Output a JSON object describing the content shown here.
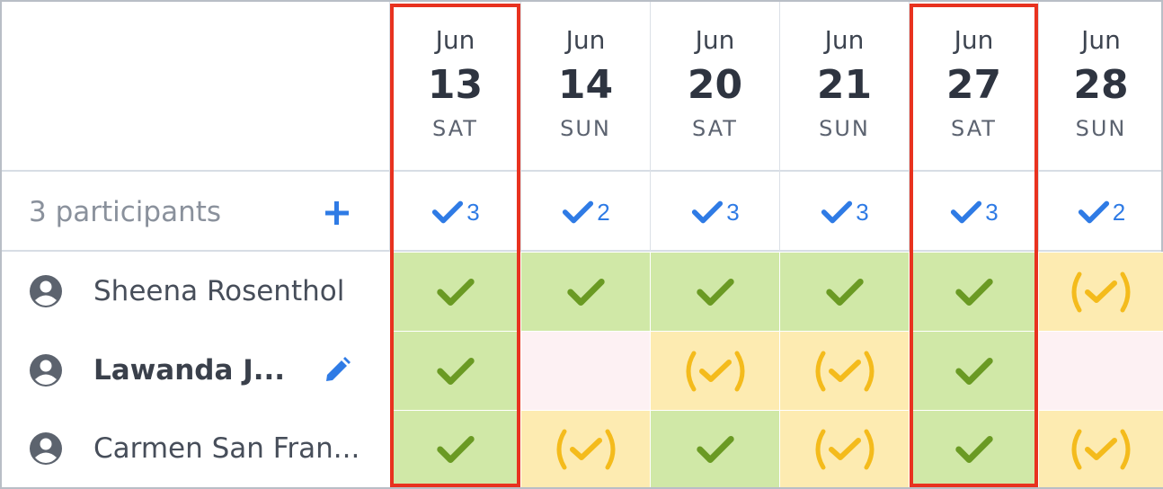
{
  "columns": [
    {
      "month": "Jun",
      "day": "13",
      "weekday": "SAT",
      "count": "3"
    },
    {
      "month": "Jun",
      "day": "14",
      "weekday": "SUN",
      "count": "2"
    },
    {
      "month": "Jun",
      "day": "20",
      "weekday": "SAT",
      "count": "3"
    },
    {
      "month": "Jun",
      "day": "21",
      "weekday": "SUN",
      "count": "3"
    },
    {
      "month": "Jun",
      "day": "27",
      "weekday": "SAT",
      "count": "3"
    },
    {
      "month": "Jun",
      "day": "28",
      "weekday": "SUN",
      "count": "2"
    }
  ],
  "participants_label": "3 participants",
  "participants": [
    {
      "name": "Sheena Rosenthol",
      "bold": false,
      "editable": false,
      "votes": [
        "yes",
        "yes",
        "yes",
        "yes",
        "yes",
        "maybe"
      ]
    },
    {
      "name": "Lawanda J...",
      "bold": true,
      "editable": true,
      "votes": [
        "yes",
        "no",
        "maybe",
        "maybe",
        "yes",
        "no"
      ]
    },
    {
      "name": "Carmen San Fran...",
      "bold": false,
      "editable": false,
      "votes": [
        "yes",
        "maybe",
        "yes",
        "maybe",
        "yes",
        "maybe"
      ]
    }
  ],
  "highlighted_columns": [
    0,
    4
  ],
  "icons": {
    "add": "plus-icon",
    "edit": "pencil-icon",
    "person": "user-circle-icon",
    "yes": "check-icon",
    "maybe": "parenthesized-check-icon",
    "count": "check-icon"
  },
  "colors": {
    "yes_bg": "#d0e8a7",
    "yes_check": "#6a9a23",
    "maybe_bg": "#fdebb1",
    "maybe_check": "#f4bb1c",
    "no_bg": "#fdf1f3",
    "accent": "#2f7be5",
    "highlight": "#e8321f"
  }
}
